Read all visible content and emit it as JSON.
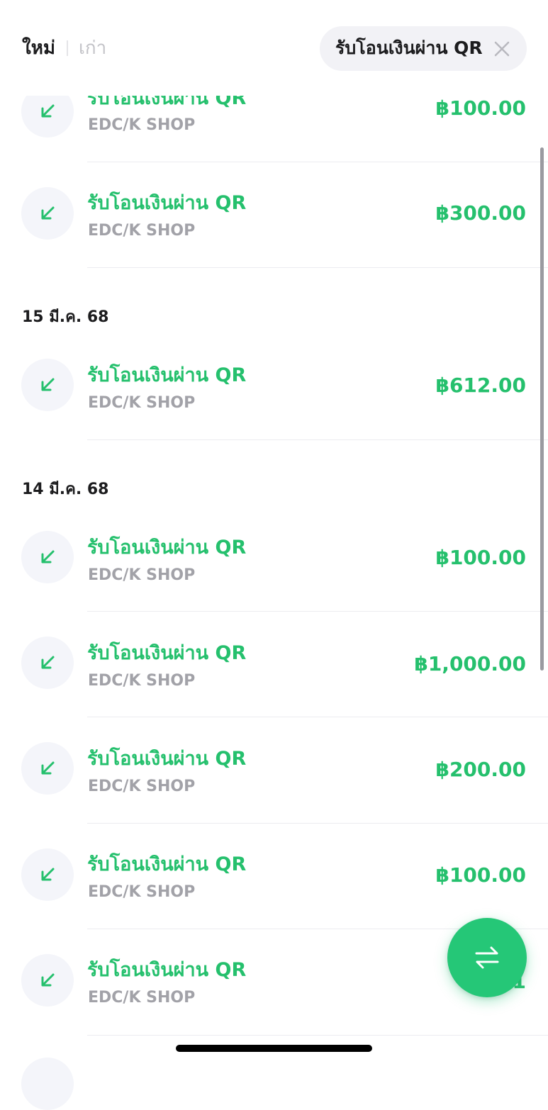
{
  "header": {
    "sort_new": "ใหม่",
    "sort_old": "เก่า",
    "filter_chip_label": "รับโอนเงินผ่าน QR",
    "filter_close_icon": "close-icon"
  },
  "colors": {
    "accent_green": "#25c06d",
    "fab_green": "#25c777",
    "subtitle_gray": "#a2a2a8"
  },
  "groups": [
    {
      "date": "",
      "transactions": [
        {
          "title": "รับโอนเงินผ่าน QR",
          "subtitle": "EDC/K SHOP",
          "amount": "฿100.00",
          "icon": "incoming-arrow-icon"
        },
        {
          "title": "รับโอนเงินผ่าน QR",
          "subtitle": "EDC/K SHOP",
          "amount": "฿300.00",
          "icon": "incoming-arrow-icon"
        }
      ]
    },
    {
      "date": "15 มี.ค. 68",
      "transactions": [
        {
          "title": "รับโอนเงินผ่าน QR",
          "subtitle": "EDC/K SHOP",
          "amount": "฿612.00",
          "icon": "incoming-arrow-icon"
        }
      ]
    },
    {
      "date": "14 มี.ค. 68",
      "transactions": [
        {
          "title": "รับโอนเงินผ่าน QR",
          "subtitle": "EDC/K SHOP",
          "amount": "฿100.00",
          "icon": "incoming-arrow-icon"
        },
        {
          "title": "รับโอนเงินผ่าน QR",
          "subtitle": "EDC/K SHOP",
          "amount": "฿1,000.00",
          "icon": "incoming-arrow-icon"
        },
        {
          "title": "รับโอนเงินผ่าน QR",
          "subtitle": "EDC/K SHOP",
          "amount": "฿200.00",
          "icon": "incoming-arrow-icon"
        },
        {
          "title": "รับโอนเงินผ่าน QR",
          "subtitle": "EDC/K SHOP",
          "amount": "฿100.00",
          "icon": "incoming-arrow-icon"
        },
        {
          "title": "รับโอนเงินผ่าน QR",
          "subtitle": "EDC/K SHOP",
          "amount": "฿1",
          "icon": "incoming-arrow-icon"
        }
      ]
    }
  ],
  "fab": {
    "icon": "transfer-arrows-icon"
  }
}
